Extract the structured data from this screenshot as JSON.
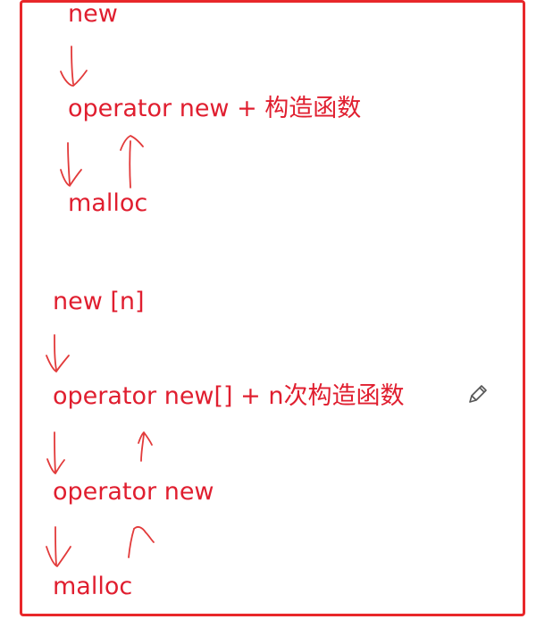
{
  "flow1": {
    "new": "new",
    "operator_new_ctor": "operator new  + 构造函数",
    "malloc": "malloc"
  },
  "flow2": {
    "new_n": "new [n]",
    "operator_new_arr": "operator new[] + n次构造函数",
    "operator_new": "operator new",
    "malloc": "malloc"
  },
  "colors": {
    "text": "#e01e2f",
    "frame": "#e8272a",
    "ink": "#e23a3a"
  },
  "icons": {
    "edit": "pencil-icon"
  }
}
